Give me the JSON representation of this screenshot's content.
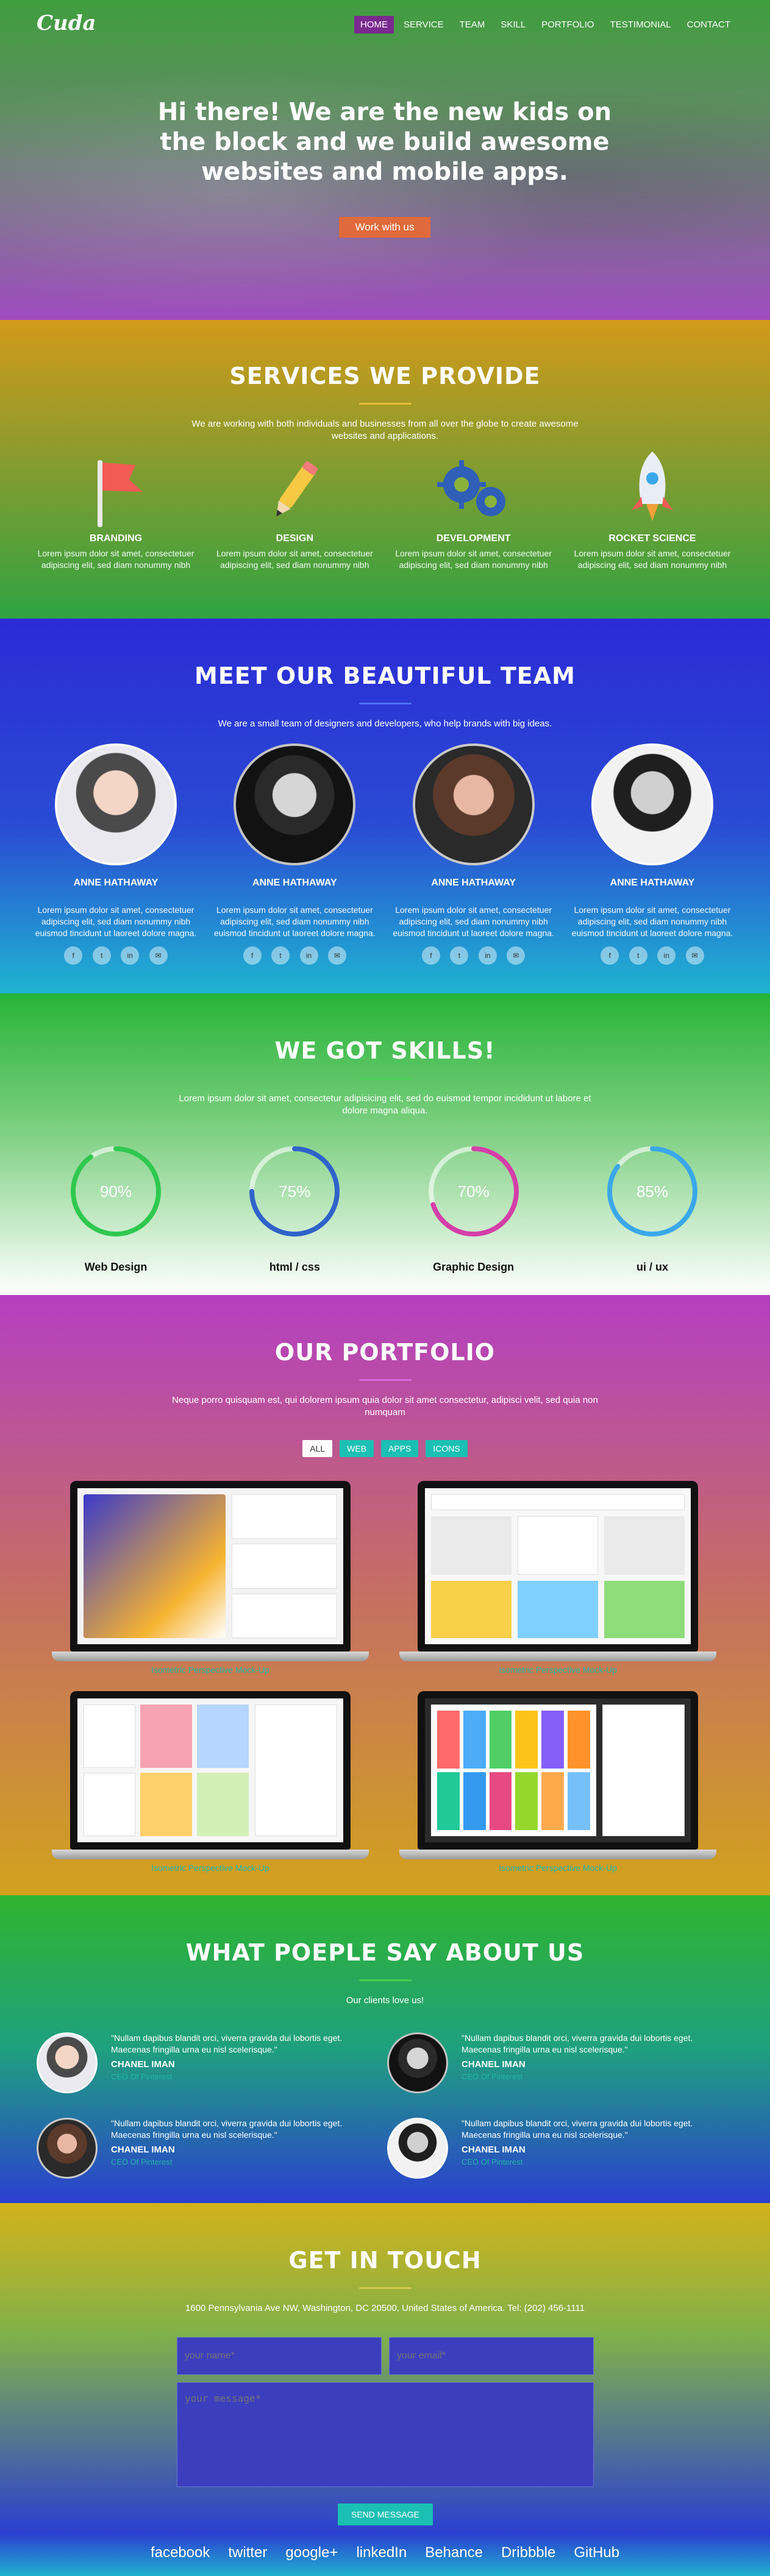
{
  "brand": {
    "logo_text": "Cuda"
  },
  "nav": {
    "items": [
      {
        "label": "HOME",
        "active": true
      },
      {
        "label": "SERVICE",
        "active": false
      },
      {
        "label": "TEAM",
        "active": false
      },
      {
        "label": "SKILL",
        "active": false
      },
      {
        "label": "PORTFOLIO",
        "active": false
      },
      {
        "label": "TESTIMONIAL",
        "active": false
      },
      {
        "label": "CONTACT",
        "active": false
      }
    ]
  },
  "hero": {
    "title": "Hi there! We are the new kids on the block and we build awesome websites and mobile apps.",
    "cta": "Work with us"
  },
  "services": {
    "title": "SERVICES WE PROVIDE",
    "lead": "We are working with both individuals and businesses from all over the globe to create awesome websites and applications.",
    "items": [
      {
        "title": "BRANDING",
        "text": "Lorem ipsum dolor sit amet, consectetuer adipiscing elit, sed diam nonummy nibh"
      },
      {
        "title": "DESIGN",
        "text": "Lorem ipsum dolor sit amet, consectetuer adipiscing elit, sed diam nonummy nibh"
      },
      {
        "title": "DEVELOPMENT",
        "text": "Lorem ipsum dolor sit amet, consectetuer adipiscing elit, sed diam nonummy nibh"
      },
      {
        "title": "ROCKET SCIENCE",
        "text": "Lorem ipsum dolor sit amet, consectetuer adipiscing elit, sed diam nonummy nibh"
      }
    ]
  },
  "team": {
    "title": "MEET OUR BEAUTIFUL TEAM",
    "lead": "We are a small team of designers and developers, who help brands with big ideas.",
    "members": [
      {
        "name": "ANNE HATHAWAY",
        "text": "Lorem ipsum dolor sit amet, consectetuer adipiscing elit, sed diam nonummy nibh euismod tincidunt ut laoreet dolore magna."
      },
      {
        "name": "ANNE HATHAWAY",
        "text": "Lorem ipsum dolor sit amet, consectetuer adipiscing elit, sed diam nonummy nibh euismod tincidunt ut laoreet dolore magna."
      },
      {
        "name": "ANNE HATHAWAY",
        "text": "Lorem ipsum dolor sit amet, consectetuer adipiscing elit, sed diam nonummy nibh euismod tincidunt ut laoreet dolore magna."
      },
      {
        "name": "ANNE HATHAWAY",
        "text": "Lorem ipsum dolor sit amet, consectetuer adipiscing elit, sed diam nonummy nibh euismod tincidunt ut laoreet dolore magna."
      }
    ],
    "social_icons": [
      "facebook-icon",
      "twitter-icon",
      "linkedin-icon",
      "email-icon"
    ]
  },
  "skills": {
    "title": "WE GOT SKILLS!",
    "lead": "Lorem ipsum dolor sit amet, consectetur adipisicing elit, sed do euismod tempor incididunt ut labore et dolore magna aliqua.",
    "items": [
      {
        "label": "Web Design",
        "value": 90,
        "display": "90%",
        "color": "#2fc84f"
      },
      {
        "label": "html / css",
        "value": 75,
        "display": "75%",
        "color": "#2f63c9"
      },
      {
        "label": "Graphic Design",
        "value": 70,
        "display": "70%",
        "color": "#d43fa8"
      },
      {
        "label": "ui / ux",
        "value": 85,
        "display": "85%",
        "color": "#3aa8e8"
      }
    ]
  },
  "portfolio": {
    "title": "OUR PORTFOLIO",
    "lead": "Neque porro quisquam est, qui dolorem ipsum quia dolor sit amet consectetur, adipisci velit, sed quia non numquam",
    "filters": [
      {
        "label": "ALL",
        "active": true
      },
      {
        "label": "WEB",
        "active": false
      },
      {
        "label": "APPS",
        "active": false
      },
      {
        "label": "ICONS",
        "active": false
      }
    ],
    "items": [
      {
        "caption": "Isometric Perspective Mock-Up",
        "screen": "isometric-screen"
      },
      {
        "caption": "Isometric Perspective Mock-Up",
        "screen": "website-screen"
      },
      {
        "caption": "Isometric Perspective Mock-Up",
        "screen": "gallery-screen"
      },
      {
        "caption": "Isometric Perspective Mock-Up",
        "screen": "icons-screen"
      }
    ]
  },
  "testimonials": {
    "title": "WHAT POEPLE SAY ABOUT US",
    "lead": "Our clients love us!",
    "items": [
      {
        "quote": "\"Nullam dapibus blandit orci, viverra gravida dui lobortis eget. Maecenas fringilla urna eu nisl scelerisque.\"",
        "name": "CHANEL IMAN",
        "role": "CEO Of Pinterest"
      },
      {
        "quote": "\"Nullam dapibus blandit orci, viverra gravida dui lobortis eget. Maecenas fringilla urna eu nisl scelerisque.\"",
        "name": "CHANEL IMAN",
        "role": "CEO Of Pinterest"
      },
      {
        "quote": "\"Nullam dapibus blandit orci, viverra gravida dui lobortis eget. Maecenas fringilla urna eu nisl scelerisque.\"",
        "name": "CHANEL IMAN",
        "role": "CEO Of Pinterest"
      },
      {
        "quote": "\"Nullam dapibus blandit orci, viverra gravida dui lobortis eget. Maecenas fringilla urna eu nisl scelerisque.\"",
        "name": "CHANEL IMAN",
        "role": "CEO Of Pinterest"
      }
    ]
  },
  "contact": {
    "title": "GET IN TOUCH",
    "address": "1600 Pennsylvania Ave NW, Washington, DC 20500, United States of America. Tel: (202) 456-1111",
    "name_placeholder": "your name*",
    "email_placeholder": "your email*",
    "message_placeholder": "your message*",
    "submit": "SEND MESSAGE"
  },
  "footer": {
    "links": [
      "facebook",
      "twitter",
      "google+",
      "linkedIn",
      "Behance",
      "Dribbble",
      "GitHub"
    ]
  },
  "colors": {
    "accent_orange": "#e06a3b",
    "teal": "#1bbfb3",
    "caption_teal": "#20b7a8"
  }
}
